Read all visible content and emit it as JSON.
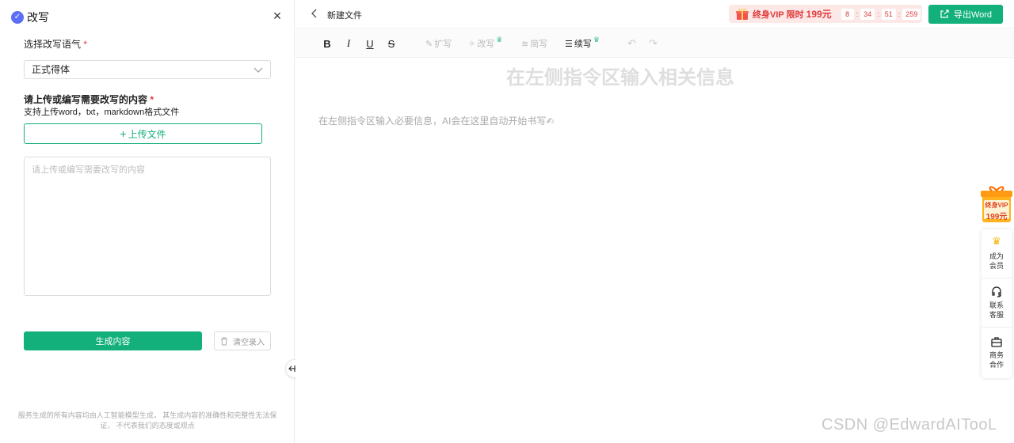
{
  "panel": {
    "title": "改写",
    "tone_label": "选择改写语气",
    "required_mark": "*",
    "tone_value": "正式得体",
    "content_label": "请上传或编写需要改写的内容",
    "formats_hint": "支持上传word，txt，markdown格式文件",
    "upload_label": "上传文件",
    "textarea_placeholder": "请上传或编写需要改写的内容",
    "generate_label": "生成内容",
    "clear_label": "清空录入",
    "disclaimer": "服务生成的所有内容均由人工智能模型生成， 其生成内容的准确性和完整性无法保证， 不代表我们的态度或观点"
  },
  "topbar": {
    "doc_title": "新建文件",
    "vip_text": "终身VIP 限时",
    "vip_price": "199元",
    "timer": [
      "8",
      "34",
      "51",
      "259"
    ],
    "export_label": "导出Word"
  },
  "toolbar": {
    "bold": "B",
    "italic": "I",
    "underline": "U",
    "strike": "S",
    "expand": "扩写",
    "rewrite": "改写",
    "simplify": "简写",
    "continue": "续写"
  },
  "editor": {
    "heading": "在左侧指令区输入相关信息",
    "hint": "在左侧指令区输入必要信息，AI会在这里自动开始书写✍"
  },
  "side": {
    "promo_line1": "终身VIP",
    "promo_line2": "199元",
    "member_l1": "成为",
    "member_l2": "会员",
    "support_l1": "联系",
    "support_l2": "客服",
    "business_l1": "商务",
    "business_l2": "合作"
  },
  "watermark": "CSDN @EdwardAITooL",
  "colors": {
    "accent": "#13b07b",
    "vip_red": "#e03a3a",
    "vip_bg": "#fde8e8"
  }
}
